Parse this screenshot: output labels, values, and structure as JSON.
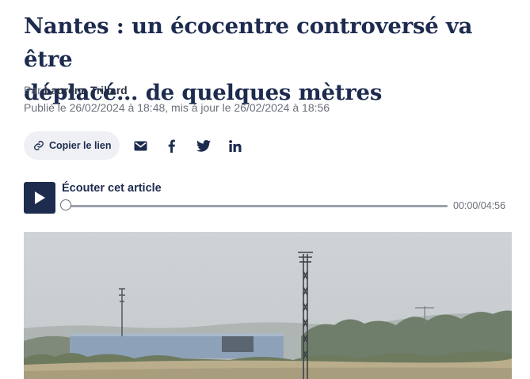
{
  "article": {
    "headline_line1": "Nantes : un écocentre controversé va être",
    "headline_line2": "déplacé… de quelques mètres",
    "byline_prefix": "Par",
    "author": "Laurène Trillard",
    "dateline": "Publié le 26/02/2024 à 18:48, mis à jour le 26/02/2024 à 18:56"
  },
  "share": {
    "copy_label": "Copier le lien",
    "icons": [
      "link-icon",
      "email-icon",
      "facebook-icon",
      "twitter-icon",
      "linkedin-icon"
    ]
  },
  "audio": {
    "title": "Écouter cet article",
    "time": "00:00/04:56",
    "progress": 0
  },
  "photo": {
    "description_icon": "landscape-photo"
  },
  "colors": {
    "navy": "#1d2b4f",
    "muted": "#6b6f7a",
    "button_bg": "#eef0f3"
  }
}
